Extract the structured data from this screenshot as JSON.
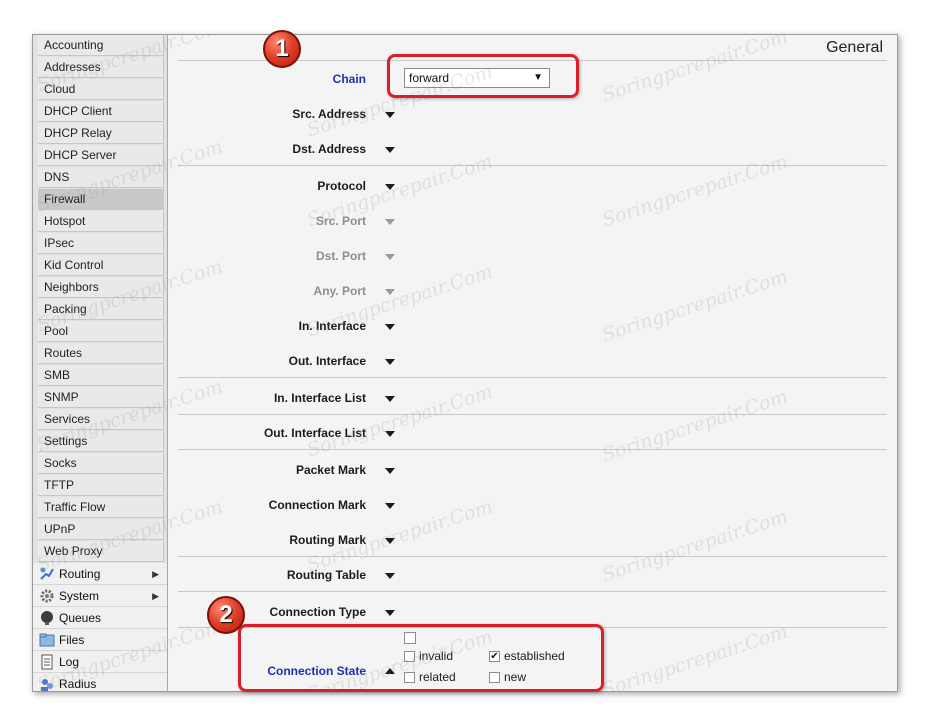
{
  "sidebar": {
    "sub_items": [
      "Accounting",
      "Addresses",
      "Cloud",
      "DHCP Client",
      "DHCP Relay",
      "DHCP Server",
      "DNS",
      "Firewall",
      "Hotspot",
      "IPsec",
      "Kid Control",
      "Neighbors",
      "Packing",
      "Pool",
      "Routes",
      "SMB",
      "SNMP",
      "Services",
      "Settings",
      "Socks",
      "TFTP",
      "Traffic Flow",
      "UPnP",
      "Web Proxy"
    ],
    "active": "Firewall",
    "main_items": [
      {
        "label": "Routing",
        "icon": "routing-icon",
        "has_submenu": true
      },
      {
        "label": "System",
        "icon": "gear-icon",
        "has_submenu": true
      },
      {
        "label": "Queues",
        "icon": "queues-icon",
        "has_submenu": false
      },
      {
        "label": "Files",
        "icon": "folder-icon",
        "has_submenu": false
      },
      {
        "label": "Log",
        "icon": "log-icon",
        "has_submenu": false
      },
      {
        "label": "Radius",
        "icon": "radius-icon",
        "has_submenu": false
      }
    ]
  },
  "section_title": "General",
  "chain": {
    "label": "Chain",
    "value": "forward"
  },
  "rows": [
    {
      "label": "Src. Address",
      "disabled": false
    },
    {
      "label": "Dst. Address",
      "disabled": false
    },
    {
      "label": "Protocol",
      "disabled": false
    },
    {
      "label": "Src. Port",
      "disabled": true
    },
    {
      "label": "Dst. Port",
      "disabled": true
    },
    {
      "label": "Any. Port",
      "disabled": true
    },
    {
      "label": "In. Interface",
      "disabled": false
    },
    {
      "label": "Out. Interface",
      "disabled": false
    },
    {
      "label": "In. Interface List",
      "disabled": false
    },
    {
      "label": "Out. Interface List",
      "disabled": false
    },
    {
      "label": "Packet Mark",
      "disabled": false
    },
    {
      "label": "Connection Mark",
      "disabled": false
    },
    {
      "label": "Routing Mark",
      "disabled": false
    },
    {
      "label": "Routing Table",
      "disabled": false
    },
    {
      "label": "Connection Type",
      "disabled": false
    }
  ],
  "connection_state": {
    "label": "Connection State",
    "options": [
      {
        "label": "invalid",
        "checked": false
      },
      {
        "label": "established",
        "checked": true
      },
      {
        "label": "related",
        "checked": false
      },
      {
        "label": "new",
        "checked": false
      }
    ]
  },
  "annotations": {
    "badge_1": "1",
    "badge_2": "2"
  },
  "watermark": "Soringpcrepair.Com",
  "colors": {
    "highlight": "#d9202a",
    "label_blue": "#1f2fb0",
    "disabled_text": "#8e8e8e"
  }
}
